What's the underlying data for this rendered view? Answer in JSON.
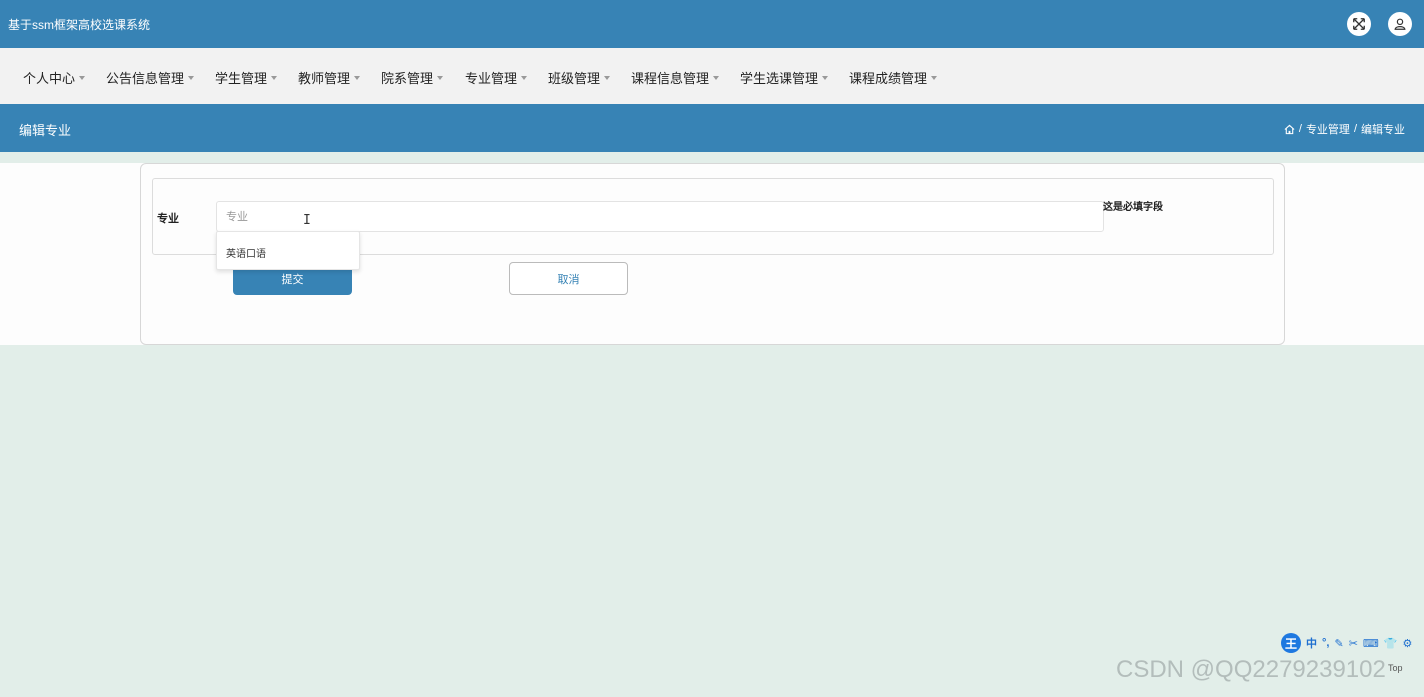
{
  "app": {
    "title": "基于ssm框架高校选课系统"
  },
  "topbar": {
    "fullscreen_icon": "fullscreen-icon",
    "user_icon": "user-icon"
  },
  "nav": {
    "items": [
      {
        "label": "个人中心"
      },
      {
        "label": "公告信息管理"
      },
      {
        "label": "学生管理"
      },
      {
        "label": "教师管理"
      },
      {
        "label": "院系管理"
      },
      {
        "label": "专业管理"
      },
      {
        "label": "班级管理"
      },
      {
        "label": "课程信息管理"
      },
      {
        "label": "学生选课管理"
      },
      {
        "label": "课程成绩管理"
      }
    ]
  },
  "header": {
    "title": "编辑专业",
    "breadcrumb": {
      "home_icon": "home-icon",
      "separator": "/",
      "parent": "专业管理",
      "current": "编辑专业"
    }
  },
  "form": {
    "field_label": "专业",
    "field_placeholder": "专业",
    "field_value": "",
    "required_note": "这是必填字段",
    "autocomplete_option": "英语口语",
    "submit_label": "提交",
    "cancel_label": "取消"
  },
  "ime": {
    "logo": "王",
    "mode": "中",
    "glyphs": [
      "°,",
      "✎",
      "✂",
      "⌨",
      "👕",
      "⚙"
    ]
  },
  "top_link": "Top",
  "watermark": "CSDN @QQ2279239102",
  "colors": {
    "primary": "#3783b5",
    "page_bg": "#e2eee9",
    "nav_bg": "#f2f2f2"
  }
}
